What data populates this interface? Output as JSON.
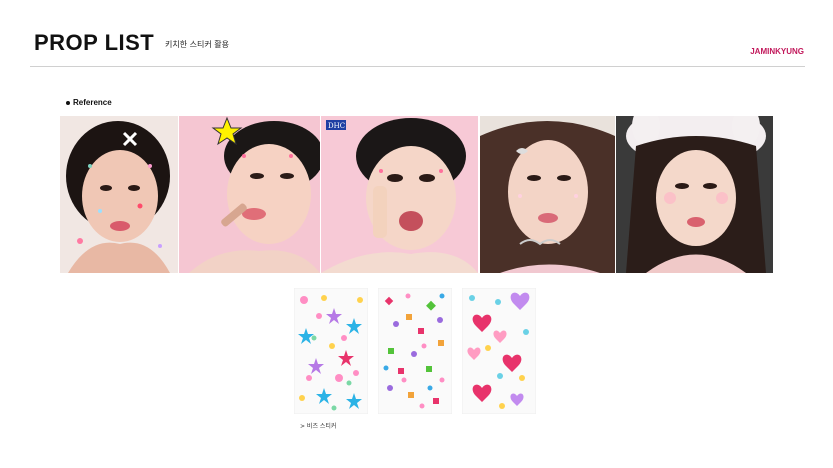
{
  "header": {
    "title": "PROP LIST",
    "subtitle": "키치한 스티커 활용",
    "brand": "JAMINKYUNG"
  },
  "reference": {
    "label": "Reference"
  },
  "photos": [
    {
      "name": "ref-photo-1",
      "description_icon": "face-with-stickers-photo"
    },
    {
      "name": "ref-photo-2",
      "description_icon": "lipstick-model-photo"
    },
    {
      "name": "ref-photo-3",
      "badge": "DHC"
    },
    {
      "name": "ref-photo-4",
      "description_icon": "ribbon-sticker-photo"
    },
    {
      "name": "ref-photo-5",
      "description_icon": "bunny-hat-photo"
    }
  ],
  "stickers": {
    "caption": "> 비즈 스티커"
  },
  "colors": {
    "brand": "#c2185b",
    "divider": "#d0d0d0",
    "star": "#fff200"
  }
}
